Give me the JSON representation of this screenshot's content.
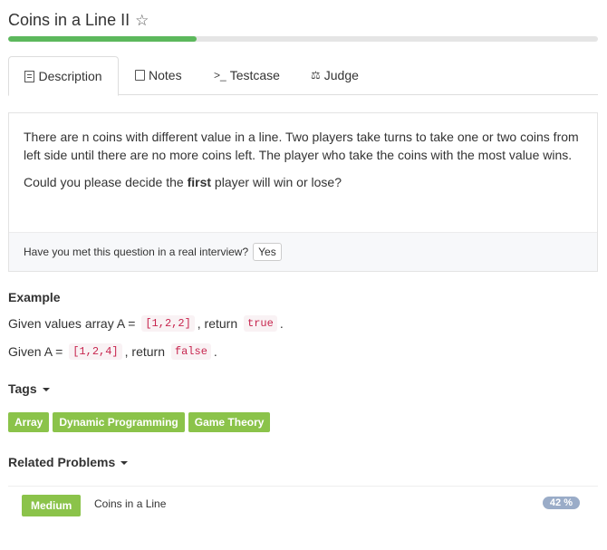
{
  "header": {
    "title": "Coins in a Line II",
    "star_icon": "star-outline-icon",
    "progress_fraction": 0.32
  },
  "tabs": [
    {
      "label": "Description",
      "icon": "document-icon",
      "active": true
    },
    {
      "label": "Notes",
      "icon": "note-icon"
    },
    {
      "label": "Testcase",
      "icon": "terminal-icon",
      "glyph": ">_"
    },
    {
      "label": "Judge",
      "icon": "scale-icon"
    }
  ],
  "description": {
    "paragraph1": "There are n coins with different value in a line. Two players take turns to take one or two coins from left side until there are no more coins left. The player who take the coins with the most value wins.",
    "q_before": "Could you please decide the ",
    "q_bold": "first",
    "q_after": " player will win or lose?",
    "interview_question": "Have you met this question in a real interview?",
    "yes_label": "Yes"
  },
  "example": {
    "title": "Example",
    "line1": {
      "prefix": "Given values array A =",
      "code1": "[1,2,2]",
      "mid": ", return",
      "code2": "true",
      "suffix": "."
    },
    "line2": {
      "prefix": "Given A =",
      "code1": "[1,2,4]",
      "mid": ", return",
      "code2": "false",
      "suffix": "."
    }
  },
  "tags": {
    "title": "Tags",
    "items": [
      "Array",
      "Dynamic Programming",
      "Game Theory"
    ]
  },
  "related": {
    "title": "Related Problems",
    "items": [
      {
        "difficulty": "Medium",
        "name": "Coins in a Line",
        "rate": "42 %"
      }
    ]
  },
  "colors": {
    "accent_green": "#5cb85c",
    "tag_green": "#8bc34a",
    "rate_badge": "#9aacc8",
    "code_red": "#c7254e"
  }
}
